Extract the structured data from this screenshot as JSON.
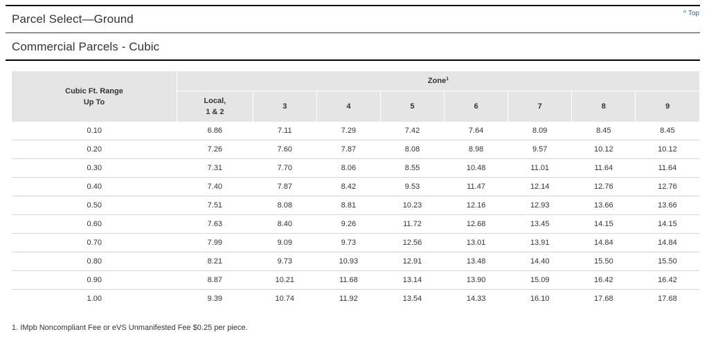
{
  "top_link": "^ Top",
  "section_title": "Parcel Select—Ground",
  "sub_title": "Commercial Parcels - Cubic",
  "table": {
    "range_header_line1": "Cubic Ft. Range",
    "range_header_line2": "Up To",
    "zone_header": "Zone",
    "zone_header_sup": "1",
    "zone_columns": [
      {
        "line1": "Local,",
        "line2": "1 & 2"
      },
      {
        "line1": "3",
        "line2": ""
      },
      {
        "line1": "4",
        "line2": ""
      },
      {
        "line1": "5",
        "line2": ""
      },
      {
        "line1": "6",
        "line2": ""
      },
      {
        "line1": "7",
        "line2": ""
      },
      {
        "line1": "8",
        "line2": ""
      },
      {
        "line1": "9",
        "line2": ""
      }
    ],
    "rows": [
      {
        "range": "0.10",
        "prices": [
          "6.86",
          "7.11",
          "7.29",
          "7.42",
          "7.64",
          "8.09",
          "8.45",
          "8.45"
        ]
      },
      {
        "range": "0.20",
        "prices": [
          "7.26",
          "7.60",
          "7.87",
          "8.08",
          "8.98",
          "9.57",
          "10.12",
          "10.12"
        ]
      },
      {
        "range": "0.30",
        "prices": [
          "7.31",
          "7.70",
          "8.06",
          "8.55",
          "10.48",
          "11.01",
          "11.64",
          "11.64"
        ]
      },
      {
        "range": "0.40",
        "prices": [
          "7.40",
          "7.87",
          "8.42",
          "9.53",
          "11.47",
          "12.14",
          "12.76",
          "12.76"
        ]
      },
      {
        "range": "0.50",
        "prices": [
          "7.51",
          "8.08",
          "8.81",
          "10.23",
          "12.16",
          "12.93",
          "13.66",
          "13.66"
        ]
      },
      {
        "range": "0.60",
        "prices": [
          "7.63",
          "8.40",
          "9.26",
          "11.72",
          "12.68",
          "13.45",
          "14.15",
          "14.15"
        ]
      },
      {
        "range": "0.70",
        "prices": [
          "7.99",
          "9.09",
          "9.73",
          "12.56",
          "13.01",
          "13.91",
          "14.84",
          "14.84"
        ]
      },
      {
        "range": "0.80",
        "prices": [
          "8.21",
          "9.73",
          "10.93",
          "12.91",
          "13.48",
          "14.40",
          "15.50",
          "15.50"
        ]
      },
      {
        "range": "0.90",
        "prices": [
          "8.87",
          "10.21",
          "11.68",
          "13.14",
          "13.90",
          "15.09",
          "16.42",
          "16.42"
        ]
      },
      {
        "range": "1.00",
        "prices": [
          "9.39",
          "10.74",
          "11.92",
          "13.54",
          "14.33",
          "16.10",
          "17.68",
          "17.68"
        ]
      }
    ]
  },
  "footnote": "1. IMpb Noncompliant Fee or eVS Unmanifested Fee $0.25 per piece.",
  "colors": {
    "header_bg": "#e5e5e5",
    "link": "#336699",
    "text": "#333333"
  }
}
